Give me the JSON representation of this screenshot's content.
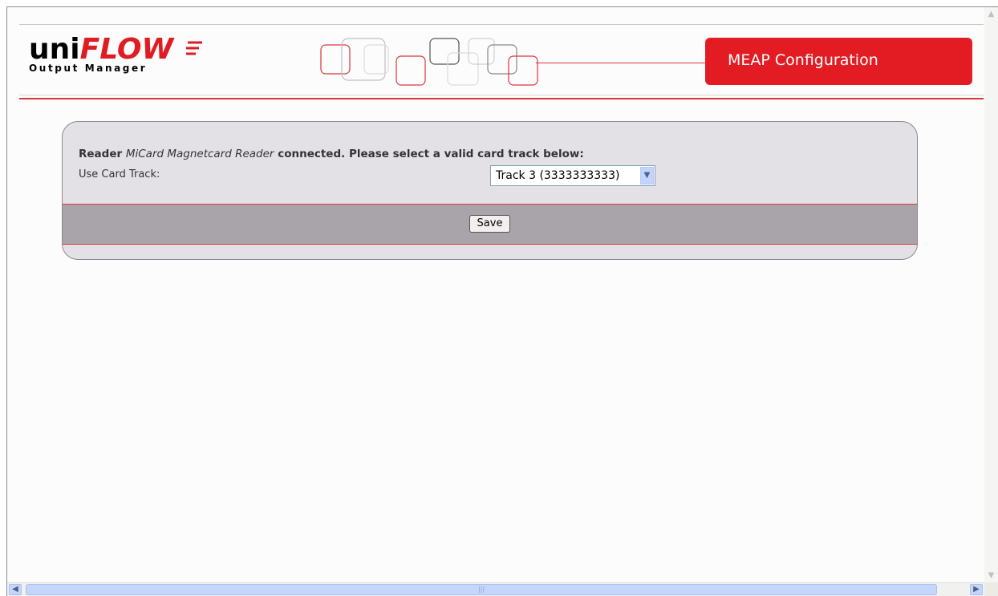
{
  "header": {
    "logo_uni": "uni",
    "logo_flow": "FLOW",
    "logo_sub": "Output Manager",
    "title": "MEAP Configuration"
  },
  "panel": {
    "message_prefix": "Reader ",
    "reader_name": "MiCard Magnetcard Reader",
    "message_suffix": " connected. Please select a valid card track below:",
    "track_label": "Use Card Track:",
    "track_selected": "Track 3 (3333333333)",
    "save_label": "Save"
  },
  "colors": {
    "brand_red": "#e31b23",
    "panel_bg": "#e3e1e6",
    "band_bg": "#a8a4aa"
  },
  "icons": {
    "select_arrow": "chevron-down-icon",
    "scroll_left": "arrow-left-icon",
    "scroll_right": "arrow-right-icon",
    "scroll_up": "arrow-up-icon",
    "scroll_down": "arrow-down-icon"
  }
}
